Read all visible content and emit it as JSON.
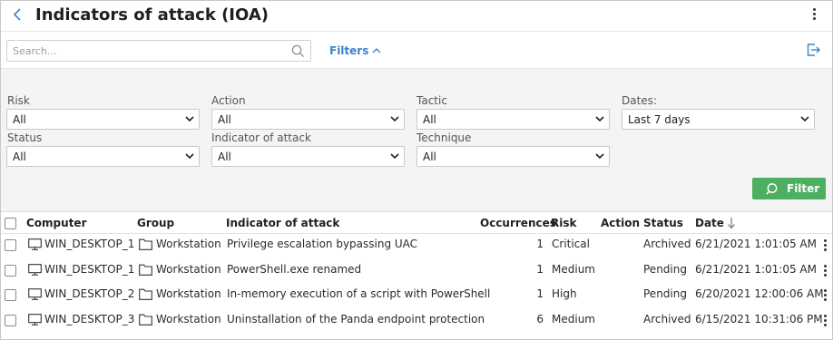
{
  "header": {
    "title": "Indicators of attack (IOA)"
  },
  "search": {
    "placeholder": "Search..."
  },
  "filters_toggle": "Filters",
  "filters": {
    "risk": {
      "label": "Risk",
      "value": "All"
    },
    "action": {
      "label": "Action",
      "value": "All"
    },
    "tactic": {
      "label": "Tactic",
      "value": "All"
    },
    "dates": {
      "label": "Dates:",
      "value": "Last 7 days"
    },
    "status": {
      "label": "Status",
      "value": "All"
    },
    "indicator": {
      "label": "Indicator of attack",
      "value": "All"
    },
    "technique": {
      "label": "Technique",
      "value": "All"
    }
  },
  "filter_button": "Filter",
  "table": {
    "columns": {
      "computer": "Computer",
      "group": "Group",
      "indicator": "Indicator of attack",
      "occurrences": "Occurrences",
      "risk": "Risk",
      "action": "Action",
      "status": "Status",
      "date": "Date"
    },
    "rows": [
      {
        "computer": "WIN_DESKTOP_1",
        "group": "Workstation",
        "indicator": "Privilege escalation bypassing UAC",
        "occurrences": "1",
        "risk": "Critical",
        "action": "",
        "status": "Archived",
        "date": "6/21/2021 1:01:05 AM"
      },
      {
        "computer": "WIN_DESKTOP_1",
        "group": "Workstation",
        "indicator": "PowerShell.exe renamed",
        "occurrences": "1",
        "risk": "Medium",
        "action": "",
        "status": "Pending",
        "date": "6/21/2021 1:01:05 AM"
      },
      {
        "computer": "WIN_DESKTOP_2",
        "group": "Workstation",
        "indicator": "In-memory execution of a script with PowerShell",
        "occurrences": "1",
        "risk": "High",
        "action": "",
        "status": "Pending",
        "date": "6/20/2021 12:00:06 AM"
      },
      {
        "computer": "WIN_DESKTOP_3",
        "group": "Workstation",
        "indicator": "Uninstallation of the Panda endpoint protection",
        "occurrences": "6",
        "risk": "Medium",
        "action": "",
        "status": "Archived",
        "date": "6/15/2021 10:31:06 PM"
      }
    ]
  },
  "colors": {
    "accent": "#3a86c8",
    "filter_button": "#4caf62",
    "panel_bg": "#f4f4f4"
  }
}
